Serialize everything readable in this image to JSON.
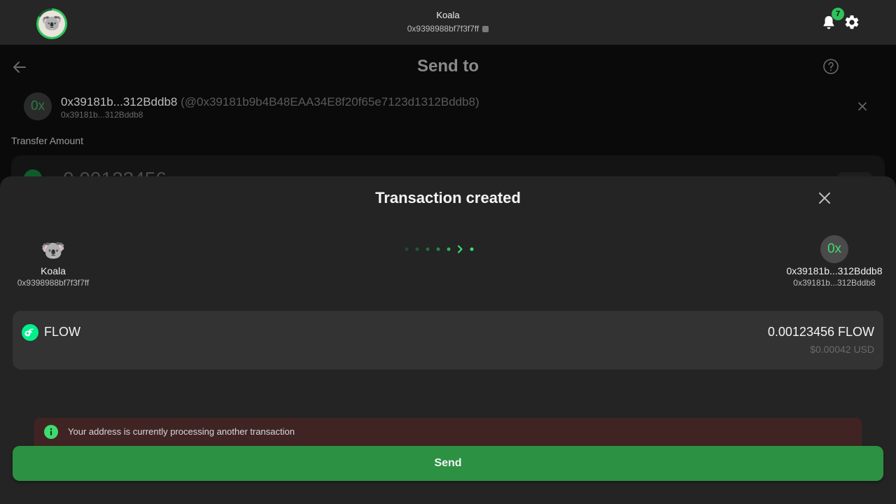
{
  "header": {
    "account_name": "Koala",
    "account_address": "0x9398988bf7f3f7ff",
    "notification_count": "7",
    "avatar_emoji": "🐨"
  },
  "page": {
    "title": "Send to",
    "recipient": {
      "avatar_label": "0x",
      "short": "0x39181b...312Bddb8",
      "full": "(@0x39181b9b4B48EAA34E8f20f65e7123d1312Bddb8)",
      "sub": "0x39181b...312Bddb8"
    },
    "transfer_label": "Transfer Amount",
    "amount_partial": "0.00123456"
  },
  "modal": {
    "title": "Transaction created",
    "from": {
      "avatar_emoji": "🐨",
      "name": "Koala",
      "address": "0x9398988bf7f3f7ff"
    },
    "to": {
      "avatar_label": "0x",
      "name": "0x39181b...312Bddb8",
      "address": "0x39181b...312Bddb8"
    },
    "token": {
      "name": "FLOW",
      "amount": "0.00123456 FLOW",
      "usd": "$0.00042 USD"
    },
    "warning": "Your address is currently processing another transaction",
    "send_label": "Send"
  },
  "colors": {
    "accent": "#2ec35a",
    "send_button": "#2d9143",
    "warning_bg": "#402424",
    "sheet_bg": "#242424",
    "header_bg": "#262626"
  },
  "icons": [
    "bell-icon",
    "gear-icon",
    "back-arrow-icon",
    "help-icon",
    "close-icon",
    "copy-icon",
    "flow-token-icon",
    "info-icon",
    "progress-chevron-icon"
  ]
}
